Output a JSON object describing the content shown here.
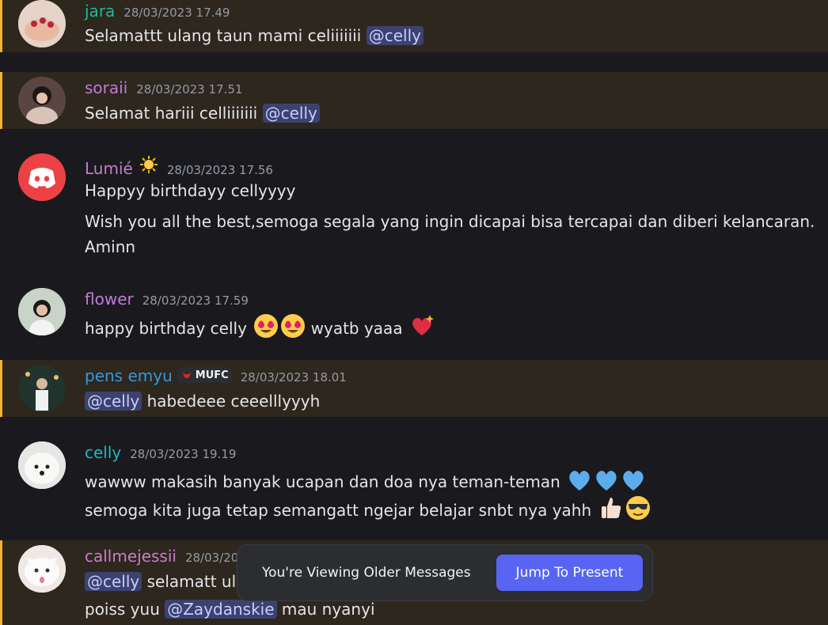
{
  "messages": [
    {
      "author": "jara",
      "author_color": "#1abc9c",
      "time": "28/03/2023 17.49",
      "text": "Selamattt ulang taun mami celiiiiiii",
      "mention": "@celly"
    },
    {
      "author": "soraii",
      "author_color": "#c27ad8",
      "time": "28/03/2023 17.51",
      "text": "Selamat hariii celliiiiiii",
      "mention": "@celly"
    },
    {
      "author": "Lumié",
      "author_color": "#c77dc9",
      "time": "28/03/2023 17.56",
      "line1": "Happyy birthdayy cellyyyy",
      "line2": "Wish you all the best,semoga segala yang ingin dicapai bisa tercapai dan diberi kelancaran.",
      "line3": "Aminn"
    },
    {
      "author": "flower",
      "author_color": "#c27ad8",
      "time": "28/03/2023 17.59",
      "text_a": "happy birthday celly",
      "text_b": "wyatb yaaa"
    },
    {
      "author": "pens emyu",
      "author_color": "#3498db",
      "tag": "MUFC",
      "time": "28/03/2023 18.01",
      "mention": "@celly",
      "text": "habedeee ceeelllyyyh"
    },
    {
      "author": "celly",
      "author_color": "#1ab8c4",
      "time": "28/03/2023 19.19",
      "line1": "wawww makasih banyak ucapan dan doa nya teman-teman",
      "line2": "semoga kita juga tetap semangatt ngejar belajar snbt nya yahh"
    },
    {
      "author": "callmejessii",
      "author_color": "#c77dc9",
      "time": "28/03/2023",
      "mention": "@celly",
      "text": "selamatt ul",
      "line2_a": "poiss yuu",
      "mention2": "@Zaydanskie",
      "line2_b": "mau nyanyi"
    }
  ],
  "banner": {
    "text": "You're Viewing Older Messages",
    "button": "Jump To Present"
  }
}
